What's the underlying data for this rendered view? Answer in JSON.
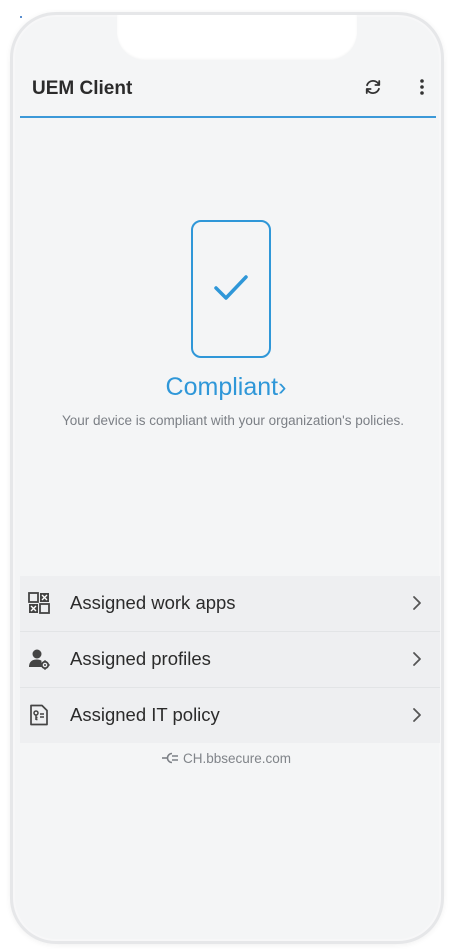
{
  "app": {
    "title": "UEM Client"
  },
  "toolbar": {
    "sync_icon": "sync-icon",
    "more_icon": "more-vertical-icon"
  },
  "status": {
    "title": "Compliant",
    "chevron": "›",
    "description": "Your device is compliant with your organization's policies.",
    "device_icon": "phone-check-icon"
  },
  "list": {
    "items": [
      {
        "label": "Assigned work apps",
        "icon": "apps-grid-icon"
      },
      {
        "label": "Assigned profiles",
        "icon": "user-gear-icon"
      },
      {
        "label": "Assigned IT policy",
        "icon": "policy-document-icon"
      }
    ]
  },
  "server": {
    "icon": "connection-plug-icon",
    "text": "CH.bbsecure.com"
  },
  "colors": {
    "accent": "#2f97d8",
    "text": "#2b2b2b",
    "muted": "#7b7f85",
    "background": "#f4f5f6"
  }
}
